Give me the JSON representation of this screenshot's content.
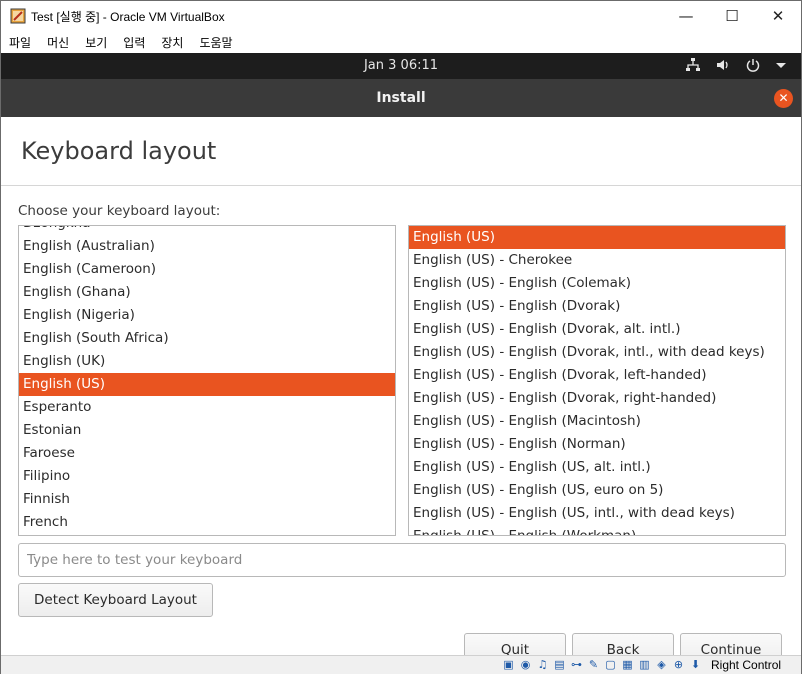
{
  "window": {
    "title": "Test [실행 중] - Oracle VM VirtualBox",
    "controls": {
      "minimize": "—",
      "maximize": "☐",
      "close": "✕"
    }
  },
  "menubar": [
    "파일",
    "머신",
    "보기",
    "입력",
    "장치",
    "도움말"
  ],
  "vm_topbar": {
    "clock": "Jan 3  06:11"
  },
  "installer": {
    "header_title": "Install",
    "heading": "Keyboard layout",
    "prompt": "Choose your keyboard layout:",
    "layouts": [
      "Dzongkha",
      "English (Australian)",
      "English (Cameroon)",
      "English (Ghana)",
      "English (Nigeria)",
      "English (South Africa)",
      "English (UK)",
      "English (US)",
      "Esperanto",
      "Estonian",
      "Faroese",
      "Filipino",
      "Finnish",
      "French"
    ],
    "selected_layout": "English (US)",
    "variants": [
      "English (US)",
      "English (US) - Cherokee",
      "English (US) - English (Colemak)",
      "English (US) - English (Dvorak)",
      "English (US) - English (Dvorak, alt. intl.)",
      "English (US) - English (Dvorak, intl., with dead keys)",
      "English (US) - English (Dvorak, left-handed)",
      "English (US) - English (Dvorak, right-handed)",
      "English (US) - English (Macintosh)",
      "English (US) - English (Norman)",
      "English (US) - English (US, alt. intl.)",
      "English (US) - English (US, euro on 5)",
      "English (US) - English (US, intl., with dead keys)",
      "English (US) - English (Workman)"
    ],
    "selected_variant": "English (US)",
    "test_placeholder": "Type here to test your keyboard",
    "detect_label": "Detect Keyboard Layout",
    "quit_label": "Quit",
    "back_label": "Back",
    "continue_label": "Continue"
  },
  "statusbar": {
    "host_key": "Right Control"
  },
  "colors": {
    "accent": "#e95420",
    "header_bg": "#3a3a3a",
    "topbar_bg": "#1d1d1d"
  }
}
